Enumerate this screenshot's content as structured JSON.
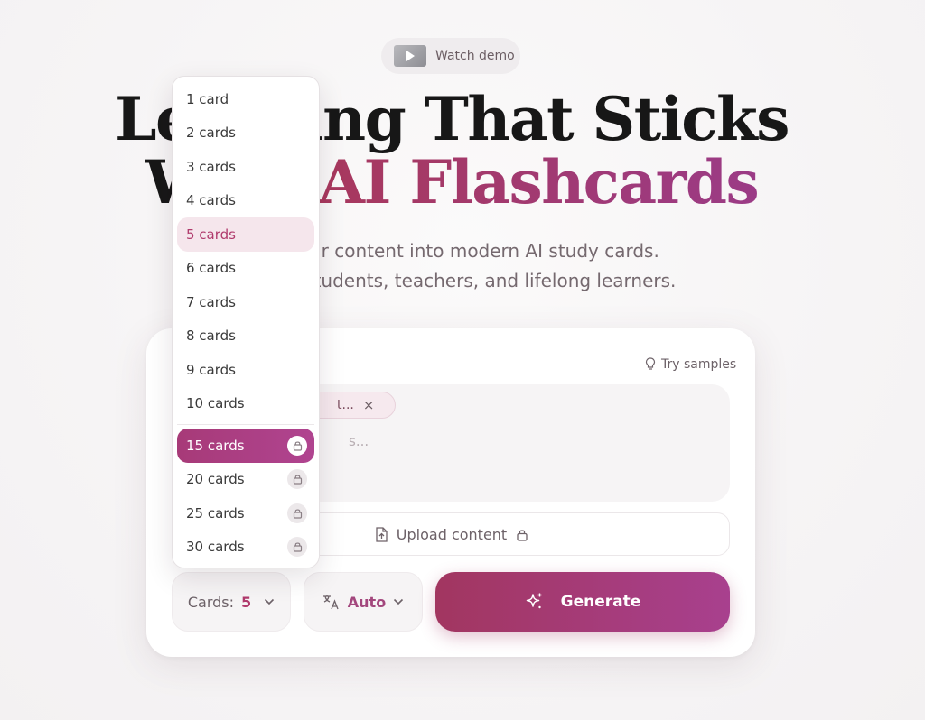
{
  "demo": {
    "label": "Watch demo"
  },
  "hero": {
    "title_line1": "Learning That Sticks",
    "title_line2_plain": "With",
    "title_line2_accent": "AI Flashcards",
    "subtitle_line1": "Turn your content into modern AI study cards.",
    "subtitle_line2": "Built for students, teachers, and lifelong learners."
  },
  "composer": {
    "try_samples": "Try samples",
    "chip_text": "t...",
    "chip_close": "×",
    "placeholder_fragment": "s...",
    "upload_label": "Upload content",
    "cards_label": "Cards:",
    "cards_value": "5",
    "language_value": "Auto",
    "generate_label": "Generate"
  },
  "dropdown": {
    "items_free": [
      "1 card",
      "2 cards",
      "3 cards",
      "4 cards",
      "5 cards",
      "6 cards",
      "7 cards",
      "8 cards",
      "9 cards",
      "10 cards"
    ],
    "items_locked": [
      "15 cards",
      "20 cards",
      "25 cards",
      "30 cards"
    ],
    "selected": "5 cards",
    "highlighted": "15 cards"
  },
  "colors": {
    "accent": "#b03a6c",
    "accent_gradient_start": "#a23660",
    "accent_gradient_end": "#a8408e",
    "selected_bg": "#f5e6ec"
  },
  "icons": [
    "video-thumbnail-icon",
    "play-icon",
    "lightbulb-icon",
    "close-icon",
    "upload-file-icon",
    "lock-icon",
    "chevron-down-icon",
    "translate-icon",
    "sparkles-icon"
  ]
}
